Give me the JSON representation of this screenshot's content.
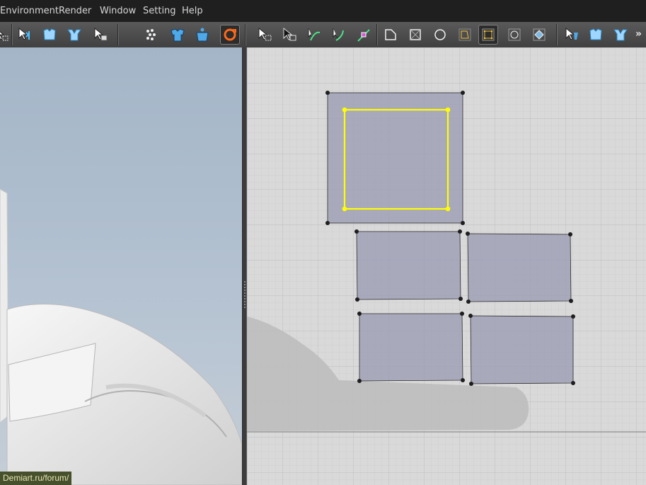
{
  "menubar": {
    "items": [
      {
        "label": "Environment"
      },
      {
        "label": "Render"
      },
      {
        "label": "Window"
      },
      {
        "label": "Setting"
      },
      {
        "label": "Help"
      }
    ]
  },
  "toolbar": {
    "tools": [
      {
        "icon": "select-mesh-icon"
      },
      {
        "icon": "select-shape-icon"
      },
      {
        "icon": "select-all-icon"
      },
      {
        "icon": "select-box-icon"
      },
      {
        "icon": "particle-distance-icon"
      },
      {
        "icon": "arrangement-icon"
      },
      {
        "icon": "avatar-arrangement-icon"
      },
      {
        "icon": "simulate-icon"
      },
      {
        "icon": "transform-pattern-icon"
      },
      {
        "icon": "edit-pattern-icon"
      },
      {
        "icon": "edit-curvature-icon"
      },
      {
        "icon": "edit-curve-point-icon"
      },
      {
        "icon": "add-point-icon"
      },
      {
        "icon": "polygon-icon"
      },
      {
        "icon": "rectangle-icon"
      },
      {
        "icon": "circle-icon"
      },
      {
        "icon": "internal-polygon-icon"
      },
      {
        "icon": "internal-rectangle-icon"
      },
      {
        "icon": "internal-circle-icon"
      },
      {
        "icon": "internal-diamond-icon"
      },
      {
        "icon": "segment-sewing-icon"
      },
      {
        "icon": "free-sewing-icon"
      },
      {
        "icon": "check-sewing-icon"
      }
    ],
    "overflow_label": "»"
  },
  "view2d": {
    "pieces": [
      {
        "name": "large-square-panel",
        "state": "with-selected-internal-rectangle"
      },
      {
        "name": "rect-panel-1"
      },
      {
        "name": "rect-panel-2"
      },
      {
        "name": "rect-panel-3"
      },
      {
        "name": "rect-panel-4"
      }
    ],
    "selection_color": "#ffff00",
    "piece_color": "#a0a0b6"
  },
  "watermark": {
    "text": "Demiart.ru/forum/"
  },
  "colors": {
    "menubar_bg": "#1f1f1f",
    "view3d_bg": "#a9b9ca",
    "view2d_bg": "#d6d6d6"
  }
}
